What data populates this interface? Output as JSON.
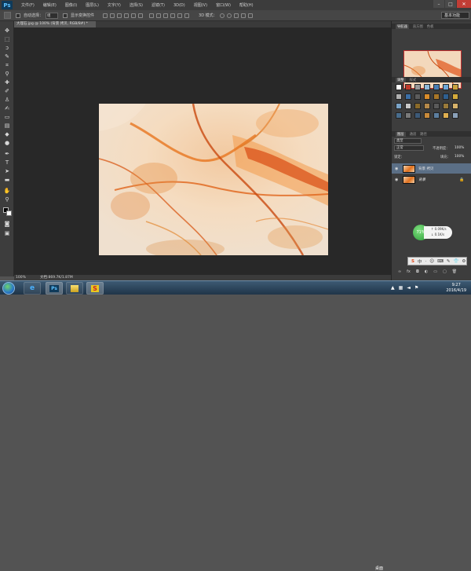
{
  "menubar": {
    "logo": "Ps",
    "items": [
      "文件(F)",
      "编辑(E)",
      "图像(I)",
      "图层(L)",
      "文字(Y)",
      "选择(S)",
      "滤镜(T)",
      "3D(D)",
      "视图(V)",
      "窗口(W)",
      "帮助(H)"
    ]
  },
  "options": {
    "auto_select": "自动选择：",
    "auto_select_value": "组",
    "show_transform": "显示变换控件",
    "mode_3d": "3D 模式：",
    "workspace": "基本功能"
  },
  "document": {
    "tab_title": "大理石.jpg @ 100% (背景 拷贝, RGB/8#) *",
    "zoom": "100%",
    "doc_size": "文档:869.7K/1.87M"
  },
  "panels": {
    "nav_tabs": [
      "导航器",
      "直方图",
      "色板"
    ],
    "adj_tabs": [
      "调整",
      "样式"
    ],
    "layer_tabs": [
      "图层",
      "通道",
      "路径"
    ],
    "kind_label": "类型",
    "blend_mode": "正常",
    "opacity_label": "不透明度：",
    "opacity_value": "100%",
    "lock_label": "锁定：",
    "fill_label": "填充：",
    "fill_value": "100%",
    "layers": [
      {
        "name": "背景 拷贝"
      },
      {
        "name": "背景"
      }
    ]
  },
  "widget": {
    "percent": "71%",
    "up": "0.09K/s",
    "down": "0.1K/s"
  },
  "ime": {
    "items": [
      "S",
      "中",
      "·",
      "☺",
      "⌨",
      "✎",
      "👕",
      "⚙"
    ]
  },
  "taskbar": {
    "desk_label": "桌面",
    "time": "9:27",
    "date": "2016/4/19"
  },
  "colors": {
    "accent": "#c43030",
    "marble_orange": "#e0701c"
  }
}
